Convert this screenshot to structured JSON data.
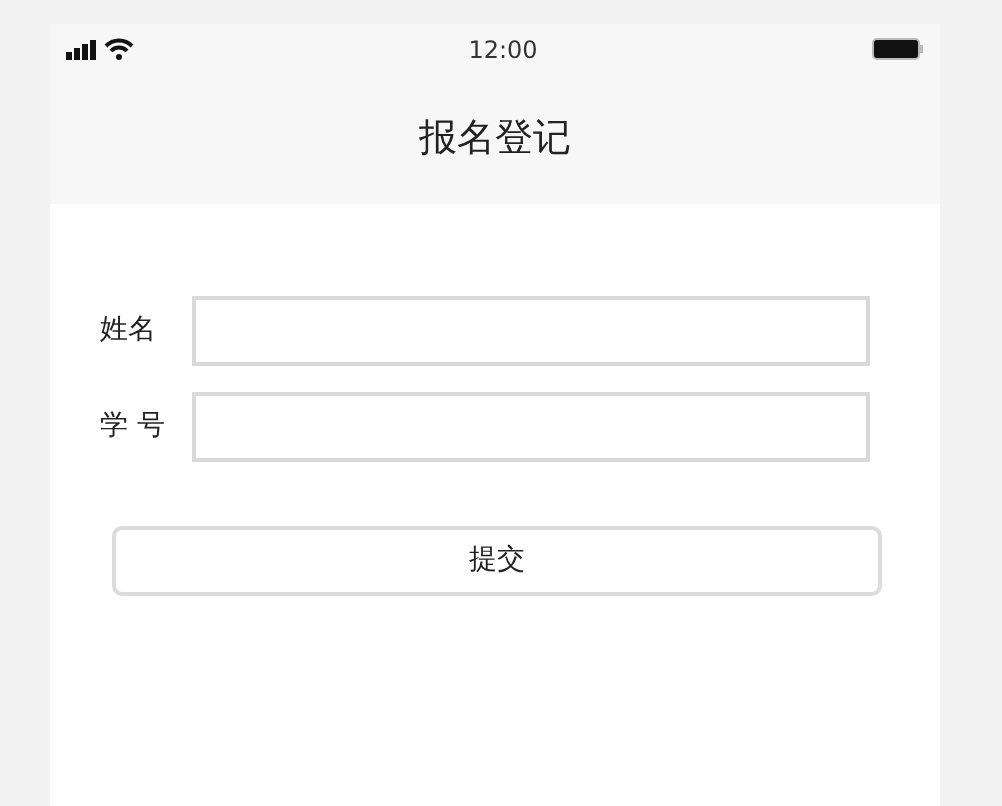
{
  "status_bar": {
    "time": "12:00"
  },
  "nav_bar": {
    "title": "报名登记"
  },
  "form": {
    "fields": [
      {
        "label": "姓名"
      },
      {
        "label": "学 号"
      }
    ],
    "submit": "提交"
  }
}
